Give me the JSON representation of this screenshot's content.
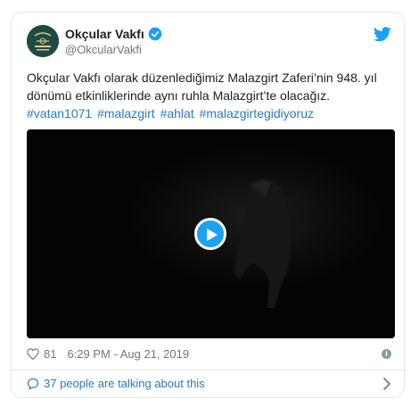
{
  "tweet": {
    "author_name": "Okçular Vakfı",
    "author_handle": "@OkcularVakfi",
    "text_line1": "Okçular Vakfı olarak düzenlediğimiz Malazgirt Zaferi’nin 948. yıl",
    "text_line2": "dönümü etkinliklerinde aynı ruhla Malazgirt’te olacağız.",
    "hashtags": [
      "#vatan1071",
      "#malazgirt",
      "#ahlat",
      "#malazgirtegidiyoruz"
    ],
    "like_count": "81",
    "timestamp": "6:29 PM - Aug 21, 2019",
    "talking_about": "37 people are talking about this"
  },
  "icons": {
    "verified": "verified-badge-icon",
    "twitter": "twitter-bird-icon",
    "heart": "heart-icon",
    "info": "info-icon",
    "bubble": "speech-bubble-icon",
    "chevron": "chevron-right-icon",
    "play": "play-icon"
  },
  "colors": {
    "link": "#2b7bb9",
    "brand": "#1da1f2",
    "muted": "#697882",
    "border": "#e1e8ed"
  }
}
